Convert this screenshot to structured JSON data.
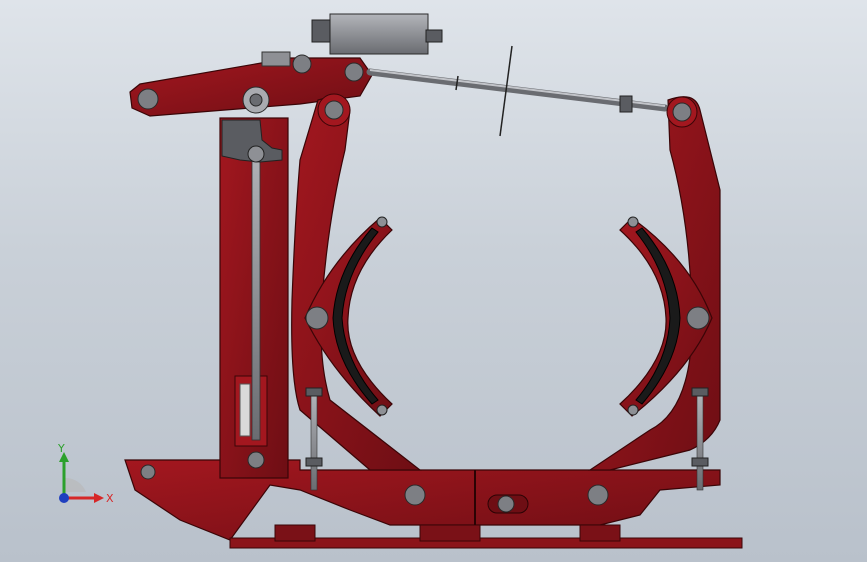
{
  "viewport": {
    "colors": {
      "background_top": "#dfe4ea",
      "background_bottom": "#b9c1cb",
      "body": "#8b141a",
      "body_dark": "#5a0b10",
      "steel": "#8e9095",
      "steel_dark": "#4d4f54",
      "shoe": "#1a1a1a"
    }
  },
  "model": {
    "name_icon": "drum-brake-assembly-icon"
  },
  "triad": {
    "y_label": "Y",
    "x_label": "X",
    "y_color": "#2ca02c",
    "x_color": "#d62728",
    "z_color": "#1f3fbf"
  }
}
